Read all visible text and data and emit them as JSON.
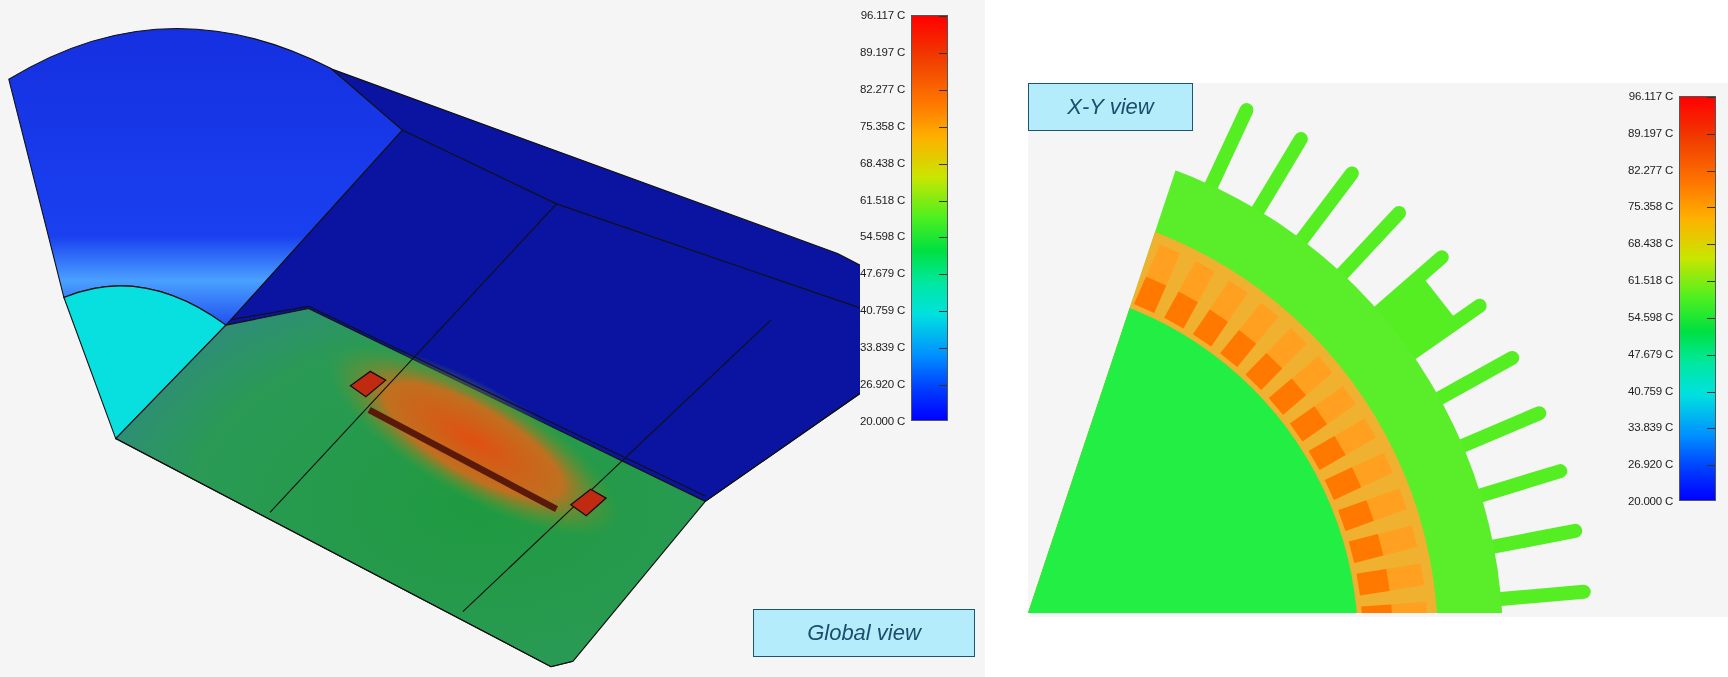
{
  "panels": [
    {
      "label": "Global view",
      "legend": [
        "96.117 C",
        "89.197 C",
        "82.277 C",
        "75.358 C",
        "68.438 C",
        "61.518 C",
        "54.598 C",
        "47.679 C",
        "40.759 C",
        "33.839 C",
        "26.920 C",
        "20.000 C"
      ]
    },
    {
      "label": "X-Y view",
      "legend": [
        "96.117 C",
        "89.197 C",
        "82.277 C",
        "75.358 C",
        "68.438 C",
        "61.518 C",
        "54.598 C",
        "47.679 C",
        "40.759 C",
        "33.839 C",
        "26.920 C",
        "20.000 C"
      ]
    }
  ]
}
